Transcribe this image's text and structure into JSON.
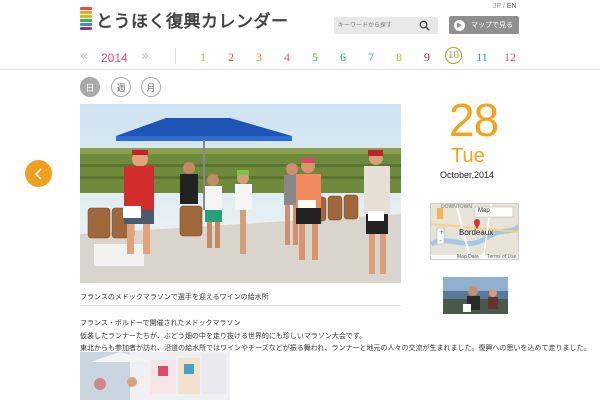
{
  "header": {
    "logo_text": "とうほく復興カレンダー",
    "lang_jp": "JP",
    "lang_sep": " / ",
    "lang_en": "EN",
    "search_placeholder": "キーワードから探す",
    "map_button_label": "マップで見る"
  },
  "nav": {
    "year": "2014",
    "months": [
      {
        "label": "1",
        "color": "#c7b62d"
      },
      {
        "label": "2",
        "color": "#e0504a"
      },
      {
        "label": "3",
        "color": "#d9a023"
      },
      {
        "label": "4",
        "color": "#e54f8f"
      },
      {
        "label": "5",
        "color": "#4aae55"
      },
      {
        "label": "6",
        "color": "#3b9a7a"
      },
      {
        "label": "7",
        "color": "#3ab0c4"
      },
      {
        "label": "8",
        "color": "#c4c024"
      },
      {
        "label": "9",
        "color": "#8a3a4a"
      },
      {
        "label": "10",
        "color": "#b89f2c"
      },
      {
        "label": "11",
        "color": "#3c8fc9"
      },
      {
        "label": "12",
        "color": "#e0506a"
      }
    ],
    "current_month": "10",
    "views": {
      "day": "日",
      "week": "週",
      "month": "月"
    }
  },
  "colors": {
    "accent_orange": "#f2a41a",
    "year_pink": "#e84b8a"
  },
  "article": {
    "caption": "フランスのメドックマラソンで選手を迎えるワインの給水所",
    "lines": [
      "フランス・ボルドーで開催されたメドックマラソン",
      "仮装したランナーたちが、ぶどう畑の中を走り抜ける世界的にも珍しいマラソン大会です。",
      "東北からも参加者が訪れ、沿道の給水所ではワインやチーズなどが振る舞われ、ランナーと地元の人々の交流が生まれました。復興への思いを込めて走りました。"
    ]
  },
  "date": {
    "day": "28",
    "weekday": "Tue",
    "month_year": "October,2014"
  },
  "map": {
    "type_label": "Map",
    "city_label": "Bordeaux",
    "area_label": "DOWNTOWN",
    "footer_data": "Map Data",
    "footer_terms": "Terms of Use"
  },
  "icons": {
    "search": "search-icon",
    "map_button": "arrow-right-icon",
    "prev": "chevron-left-icon",
    "pin": "map-pin-icon",
    "play": "play-icon"
  }
}
